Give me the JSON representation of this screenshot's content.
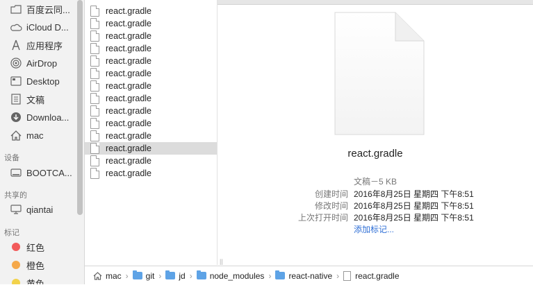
{
  "sidebar": {
    "items": [
      {
        "label": "百度云同...",
        "icon": "folder-icon"
      },
      {
        "label": "iCloud D...",
        "icon": "cloud-icon"
      },
      {
        "label": "应用程序",
        "icon": "applications-icon"
      },
      {
        "label": "AirDrop",
        "icon": "airdrop-icon"
      },
      {
        "label": "Desktop",
        "icon": "desktop-icon"
      },
      {
        "label": "文稿",
        "icon": "documents-icon"
      },
      {
        "label": "Downloa...",
        "icon": "downloads-icon"
      },
      {
        "label": "mac",
        "icon": "home-icon"
      }
    ],
    "devices_header": "设备",
    "devices": [
      {
        "label": "BOOTCA...",
        "icon": "disk-icon"
      }
    ],
    "shared_header": "共享的",
    "shared": [
      {
        "label": "qiantai",
        "icon": "computer-icon"
      }
    ],
    "tags_header": "标记",
    "tags": [
      {
        "label": "红色",
        "color": "#f25a5a"
      },
      {
        "label": "橙色",
        "color": "#f5a84a"
      },
      {
        "label": "黄色",
        "color": "#f2d24a"
      }
    ]
  },
  "files": [
    "react.gradle",
    "react.gradle",
    "react.gradle",
    "react.gradle",
    "react.gradle",
    "react.gradle",
    "react.gradle",
    "react.gradle",
    "react.gradle",
    "react.gradle",
    "react.gradle",
    "react.gradle",
    "react.gradle",
    "react.gradle"
  ],
  "selected_index": 11,
  "preview": {
    "name": "react.gradle",
    "kind": "文稿－5 KB",
    "created_label": "创建时间",
    "created_value": "2016年8月25日 星期四 下午8:51",
    "modified_label": "修改时间",
    "modified_value": "2016年8月25日 星期四 下午8:51",
    "opened_label": "上次打开时间",
    "opened_value": "2016年8月25日 星期四 下午8:51",
    "add_tags": "添加标记...",
    "resize_handle": "||"
  },
  "pathbar": {
    "crumbs": [
      "mac",
      "git",
      "jd",
      "node_modules",
      "react-native",
      "react.gradle"
    ]
  }
}
